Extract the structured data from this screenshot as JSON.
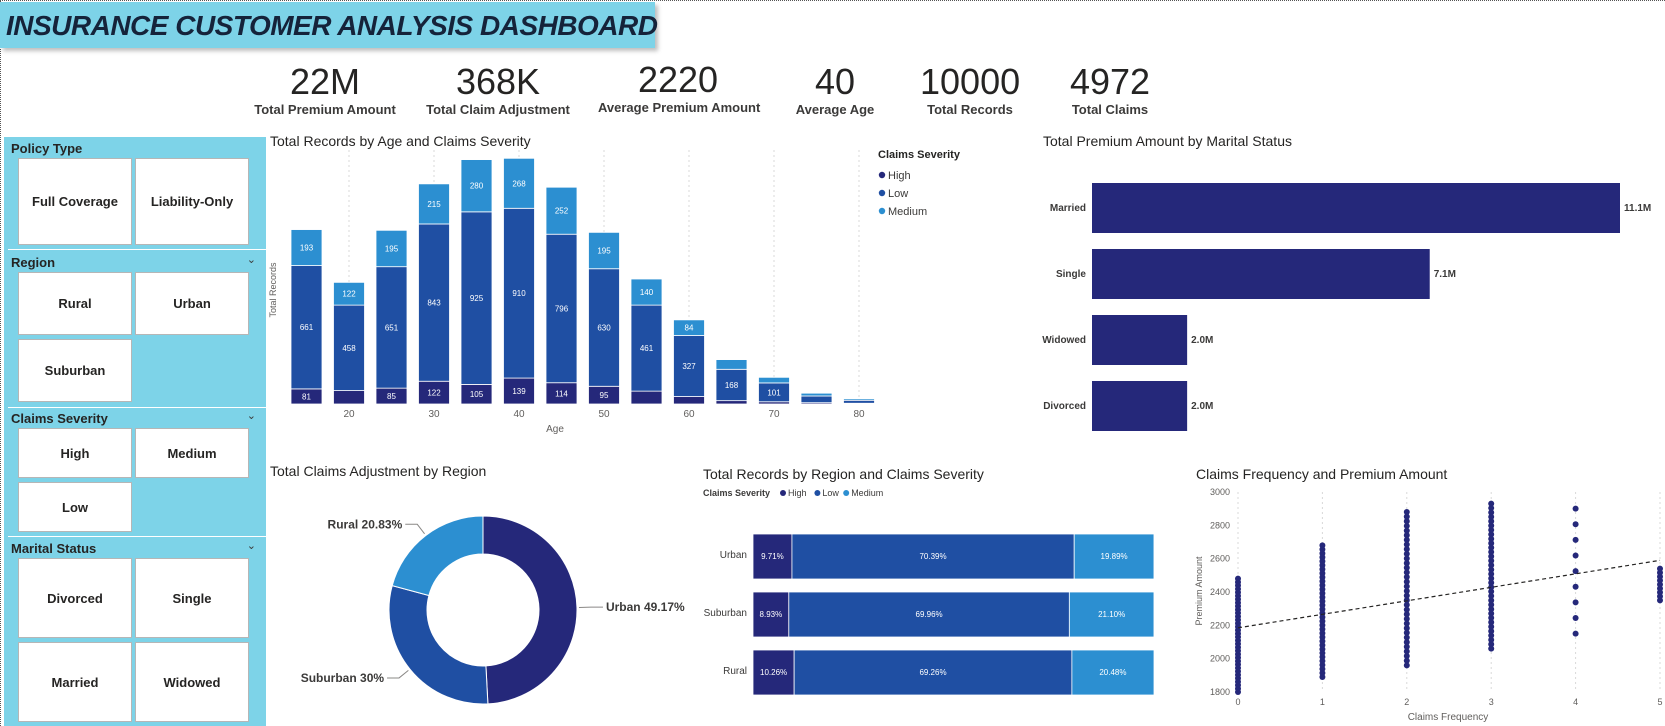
{
  "dashboard": {
    "title": "INSURANCE CUSTOMER ANALYSIS DASHBOARD"
  },
  "kpis": [
    {
      "value": "22M",
      "label": "Total Premium Amount"
    },
    {
      "value": "368K",
      "label": "Total Claim Adjustment"
    },
    {
      "value": "2220",
      "label": "Average Premium Amount"
    },
    {
      "value": "40",
      "label": "Average Age"
    },
    {
      "value": "10000",
      "label": "Total Records"
    },
    {
      "value": "4972",
      "label": "Total Claims"
    }
  ],
  "slicers": {
    "policy_type": {
      "header": "Policy Type",
      "options": [
        "Full Coverage",
        "Liability-Only"
      ]
    },
    "region": {
      "header": "Region",
      "options": [
        "Rural",
        "Urban",
        "Suburban"
      ]
    },
    "claims_severity": {
      "header": "Claims Severity",
      "options": [
        "High",
        "Medium",
        "Low"
      ]
    },
    "marital_status": {
      "header": "Marital Status",
      "options": [
        "Divorced",
        "Single",
        "Married",
        "Widowed"
      ]
    }
  },
  "colors": {
    "high": "#25287a",
    "low": "#1f4fa3",
    "medium": "#2c8fd1",
    "accent_panel": "#7dd3e8"
  },
  "chart_data": [
    {
      "id": "age_severity",
      "type": "bar",
      "stacked": true,
      "title": "Total Records by Age and Claims Severity",
      "xlabel": "Age",
      "ylabel": "Total Records",
      "x_ticks": [
        "20",
        "30",
        "40",
        "50",
        "60",
        "70",
        "80"
      ],
      "categories": [
        15,
        20,
        25,
        30,
        35,
        40,
        45,
        50,
        55,
        60,
        65,
        70,
        75,
        80
      ],
      "legend_title": "Claims Severity",
      "legend_position": "right",
      "series": [
        {
          "name": "High",
          "values": [
            81,
            72,
            85,
            122,
            105,
            139,
            114,
            95,
            69,
            40,
            18,
            12,
            7,
            4
          ]
        },
        {
          "name": "Low",
          "values": [
            661,
            458,
            651,
            843,
            925,
            910,
            796,
            630,
            461,
            327,
            168,
            101,
            36,
            16
          ]
        },
        {
          "name": "Medium",
          "values": [
            193,
            122,
            195,
            215,
            280,
            268,
            252,
            195,
            140,
            84,
            52,
            30,
            15,
            8
          ]
        }
      ],
      "ylim": [
        0,
        1340
      ]
    },
    {
      "id": "premium_marital",
      "type": "bar",
      "orientation": "horizontal",
      "title": "Total Premium Amount by Marital Status",
      "categories": [
        "Married",
        "Single",
        "Widowed",
        "Divorced"
      ],
      "values": [
        11.1,
        7.1,
        2.0,
        2.0
      ],
      "value_labels": [
        "11.1M",
        "7.1M",
        "2.0M",
        "2.0M"
      ],
      "unit": "M"
    },
    {
      "id": "claims_adj_region",
      "type": "pie",
      "donut": true,
      "title": "Total Claims Adjustment by Region",
      "categories": [
        "Urban",
        "Suburban",
        "Rural"
      ],
      "values": [
        49.17,
        30.0,
        20.83
      ],
      "labels": [
        "Urban 49.17%",
        "Suburban 30%",
        "Rural 20.83%"
      ]
    },
    {
      "id": "region_severity",
      "type": "bar",
      "orientation": "horizontal",
      "stacked_percent": true,
      "title": "Total Records by Region and Claims Severity",
      "legend_title": "Claims Severity",
      "legend_position": "top-left",
      "categories": [
        "Urban",
        "Suburban",
        "Rural"
      ],
      "series": [
        {
          "name": "High",
          "values": [
            9.71,
            8.93,
            10.26
          ],
          "labels": [
            "9.71%",
            "8.93%",
            "10.26%"
          ]
        },
        {
          "name": "Low",
          "values": [
            70.39,
            69.96,
            69.26
          ],
          "labels": [
            "70.39%",
            "69.96%",
            "69.26%"
          ]
        },
        {
          "name": "Medium",
          "values": [
            19.89,
            21.1,
            20.48
          ],
          "labels": [
            "19.89%",
            "21.10%",
            "20.48%"
          ]
        }
      ]
    },
    {
      "id": "freq_premium",
      "type": "scatter",
      "title": "Claims Frequency and Premium Amount",
      "xlabel": "Claims Frequency",
      "ylabel": "Premium Amount",
      "x_ticks": [
        "0",
        "1",
        "2",
        "3",
        "4",
        "5"
      ],
      "y_ticks": [
        "1800",
        "2000",
        "2200",
        "2400",
        "2600",
        "2800",
        "3000"
      ],
      "xlim": [
        0,
        5
      ],
      "ylim": [
        1800,
        3000
      ],
      "trendline": {
        "x": [
          0,
          5
        ],
        "y": [
          2185,
          2590
        ]
      },
      "points": [
        {
          "x": 0,
          "ymin": 1800,
          "ymax": 2480
        },
        {
          "x": 1,
          "ymin": 1890,
          "ymax": 2680
        },
        {
          "x": 2,
          "ymin": 1960,
          "ymax": 2880
        },
        {
          "x": 3,
          "ymin": 2060,
          "ymax": 2930
        },
        {
          "x": 4,
          "ymin": 2150,
          "ymax": 2900,
          "sparse": true
        },
        {
          "x": 5,
          "ymin": 2350,
          "ymax": 2540,
          "sparse": true
        }
      ]
    }
  ]
}
